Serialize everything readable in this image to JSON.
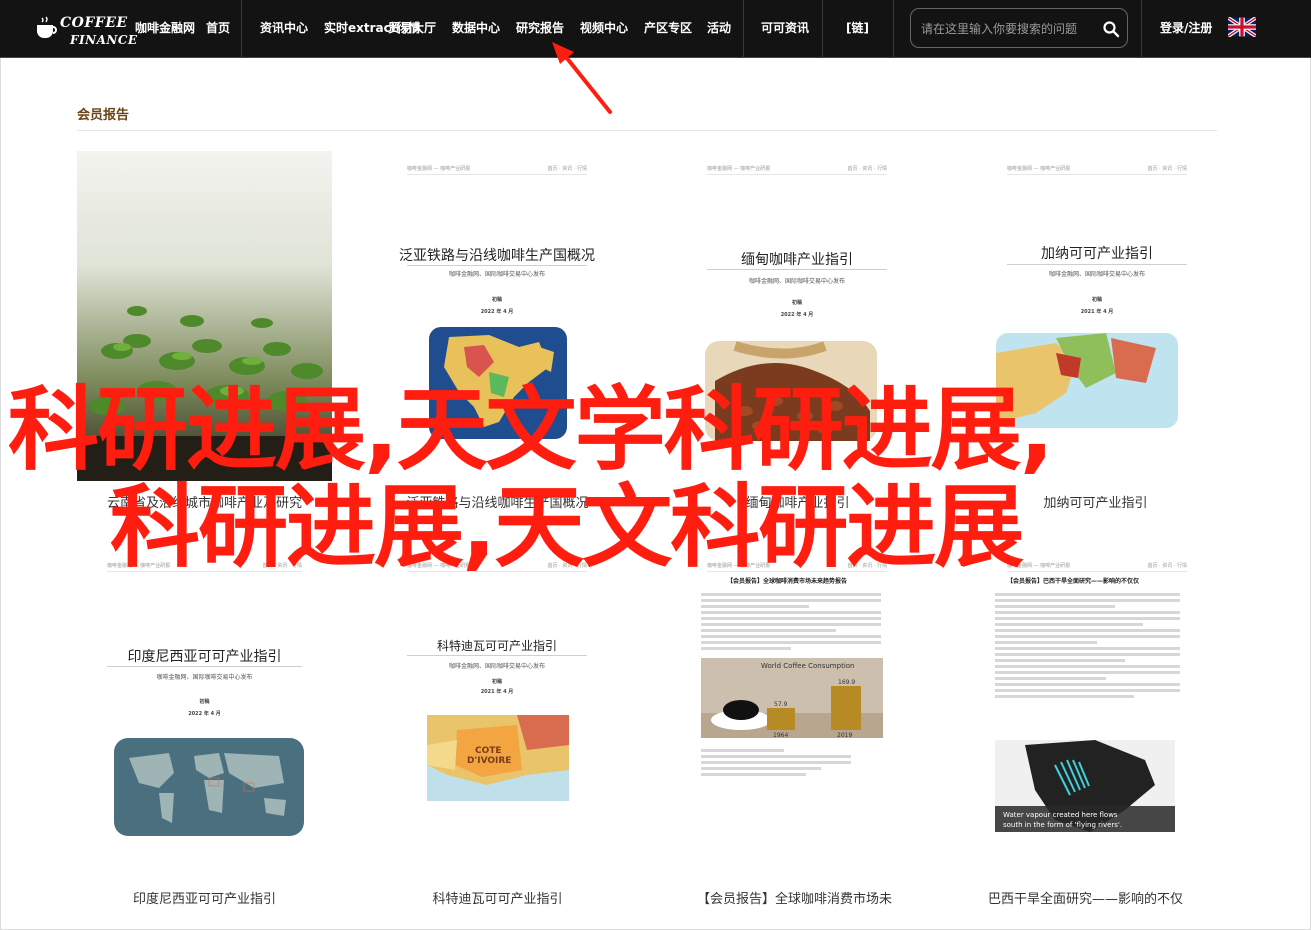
{
  "logo": {
    "line1": "COFFEE",
    "line2": "FINANCE"
  },
  "nav": {
    "items": [
      "咖啡金融网",
      "首页",
      "资讯中心",
      "实时extract行情",
      "贸易大厅",
      "数据中心",
      "研究报告",
      "视频中心",
      "产区专区",
      "活动",
      "可可资讯",
      "[链]"
    ],
    "login": "登录/注册"
  },
  "search": {
    "placeholder": "请在这里输入你要搜索的问题"
  },
  "section": {
    "title": "会员报告"
  },
  "cards": [
    {
      "title": "",
      "sub": "",
      "date": "",
      "caption": "云南省及沿线城市咖啡产业及研究"
    },
    {
      "title": "泛亚铁路与沿线咖啡生产国概况",
      "sub": "咖啡金融网、国际咖啡交易中心发布",
      "date": "2022 年 4 月",
      "caption": "泛亚铁路与沿线咖啡生产国概况"
    },
    {
      "title": "缅甸咖啡产业指引",
      "sub": "咖啡金融网、国际咖啡交易中心发布",
      "date": "2022 年 4 月",
      "caption": "缅甸咖啡产业指引"
    },
    {
      "title": "加纳可可产业指引",
      "sub": "咖啡金融网、国际咖啡交易中心发布",
      "date": "2021 年 4 月",
      "caption": "加纳可可产业指引"
    },
    {
      "title": "印度尼西亚可可产业指引",
      "sub": "咖啡金融网、国际咖啡交易中心发布",
      "date": "2022 年 4 月",
      "caption": "印度尼西亚可可产业指引"
    },
    {
      "title": "科特迪瓦可可产业指引",
      "sub": "咖啡金融网、国际咖啡交易中心发布",
      "date": "2021 年 4 月",
      "caption": "科特迪瓦可可产业指引"
    },
    {
      "title": "【会员报告】全球咖啡消费市场未来趋势报告",
      "chart_title": "World Coffee Consumption",
      "chart_v1": "57.9",
      "chart_v2": "169.9",
      "chart_y1": "1964",
      "chart_y2": "2019",
      "caption": "【会员报告】全球咖啡消费市场未"
    },
    {
      "title": "【会员报告】巴西干旱全面研究——影响的不仅仅",
      "map_text": "Water vapour created here flows south in the form of 'flying rivers'.",
      "caption": "巴西干旱全面研究——影响的不仅"
    }
  ],
  "overlay": {
    "line1": "科研进展,天文学科研进展,",
    "line2": "科研进展,天文科研进展"
  },
  "colors": {
    "nav_bg": "#131313",
    "accent_red": "#ff1d0f",
    "section_title": "#6b4411"
  }
}
